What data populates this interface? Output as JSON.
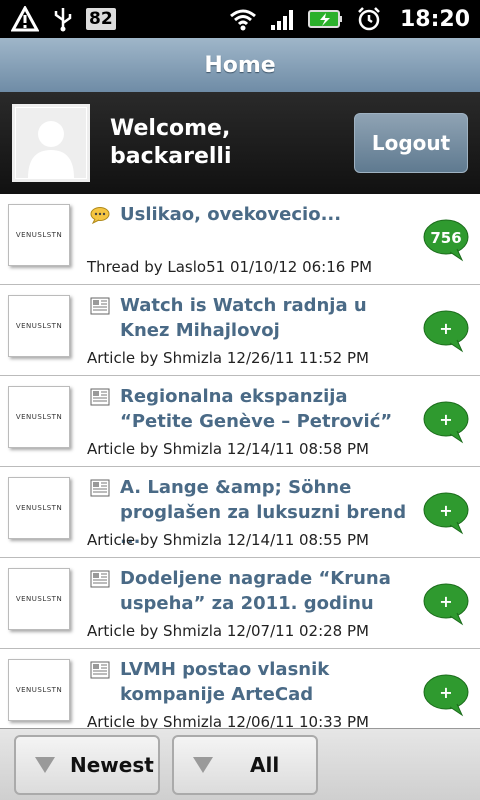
{
  "status_bar": {
    "left_icons": [
      "alert-icon",
      "usb-icon"
    ],
    "badge": "82",
    "right_icons": [
      "wifi-icon",
      "signal-icon",
      "battery-icon",
      "alarm-icon"
    ],
    "time": "18:20"
  },
  "header": {
    "title": "Home"
  },
  "welcome": {
    "line1": "Welcome,",
    "line2": "backarelli",
    "logout_label": "Logout"
  },
  "items": [
    {
      "type": "thread",
      "thumb_text": "VENUSLSTN",
      "title": "Uslikao, ovekovecio...",
      "meta": "Thread by Laslo51 01/10/12 06:16 PM",
      "count": "756"
    },
    {
      "type": "article",
      "thumb_text": "VENUSLSTN",
      "title": "Watch is Watch radnja u Knez Mihajlovoj",
      "meta": "Article by Shmizla 12/26/11 11:52 PM",
      "count": "+"
    },
    {
      "type": "article",
      "thumb_text": "VENUSLSTN",
      "title": "Regionalna ekspanzija “Petite Genève – Petrović”",
      "meta": "Article by Shmizla 12/14/11 08:58 PM",
      "count": "+"
    },
    {
      "type": "article",
      "thumb_text": "VENUSLSTN",
      "title": "A. Lange &amp; Söhne proglašen za luksuzni brend ...",
      "meta": "Article by Shmizla 12/14/11 08:55 PM",
      "count": "+"
    },
    {
      "type": "article",
      "thumb_text": "VENUSLSTN",
      "title": "Dodeljene nagrade “Kruna uspeha” za 2011. godinu",
      "meta": "Article by Shmizla 12/07/11 02:28 PM",
      "count": "+"
    },
    {
      "type": "article",
      "thumb_text": "VENUSLSTN",
      "title": "LVMH postao vlasnik kompanije ArteCad",
      "meta": "Article by Shmizla 12/06/11 10:33 PM",
      "count": "+"
    }
  ],
  "bottom": {
    "sort_label": "Newest",
    "filter_label": "All"
  },
  "colors": {
    "accent": "#4a6a86",
    "bubble_green": "#2f9a2f"
  }
}
